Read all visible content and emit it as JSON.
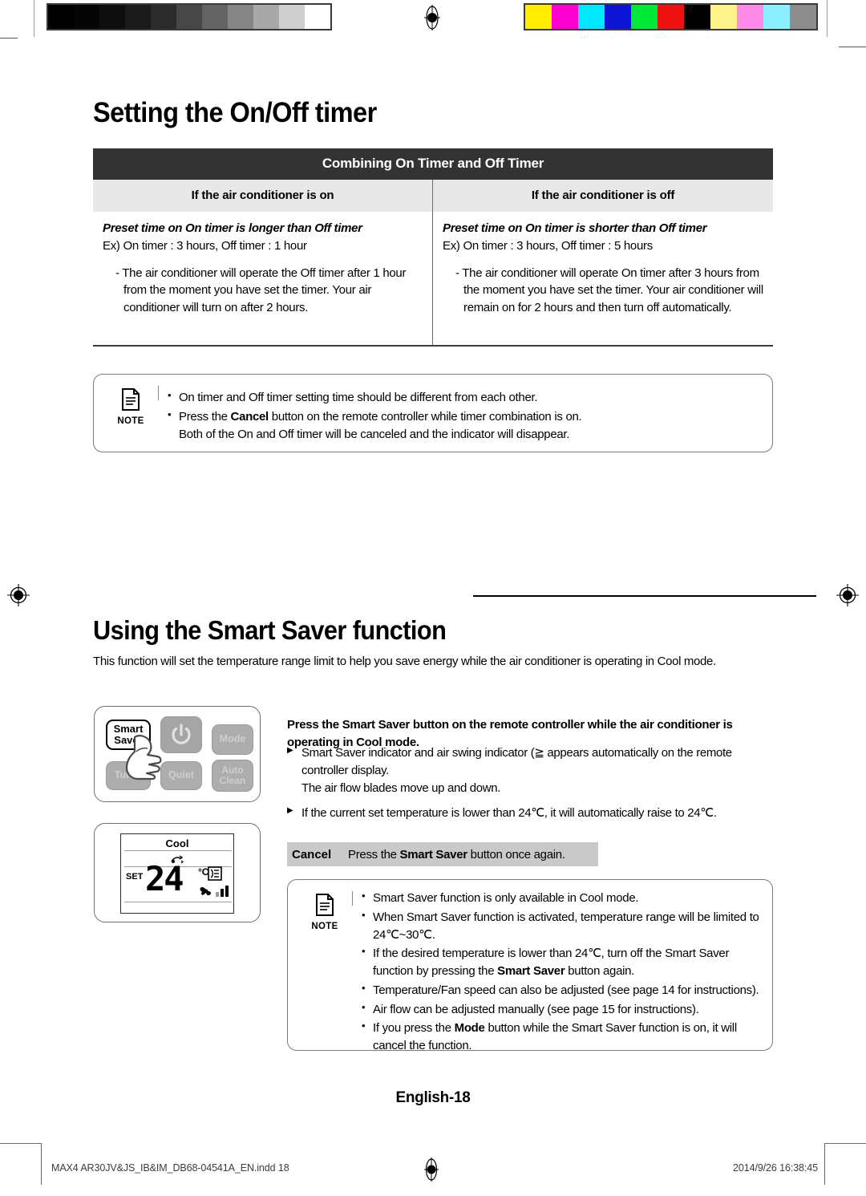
{
  "calibration": {
    "gray_ramp": [
      "#000000",
      "#050505",
      "#0d0d0d",
      "#1a1a1a",
      "#2b2b2b",
      "#474747",
      "#636363",
      "#858585",
      "#a8a8a8",
      "#cfcfcf",
      "#ffffff"
    ],
    "color_ramp": [
      "#ffee00",
      "#ff00d0",
      "#00e8ff",
      "#0e14d6",
      "#00e838",
      "#ee1111",
      "#000000",
      "#fdf38a",
      "#ff8ae8",
      "#8af0ff",
      "#8d8d8d"
    ],
    "reg_mark_icon": "registration-target-icon"
  },
  "section1": {
    "heading": "Setting the On/Off timer",
    "table": {
      "title": "Combining On Timer and Off Timer",
      "columns": [
        "If the air conditioner is on",
        "If the air conditioner is off"
      ],
      "cells": [
        {
          "caption": "Preset time on On timer is longer than Off timer",
          "example": "Ex) On timer : 3 hours, Off timer : 1 hour",
          "detail": "- The air conditioner will operate the Off timer after 1 hour from the moment you have set the timer. Your air conditioner will turn on after 2 hours."
        },
        {
          "caption": "Preset time on On timer is shorter than Off timer",
          "example": "Ex) On timer : 3 hours, Off timer : 5 hours",
          "detail": "- The air conditioner will operate On timer after 3 hours from the moment you have set the timer. Your air conditioner will remain on for 2 hours and then turn off automatically."
        }
      ]
    },
    "note": {
      "label": "NOTE",
      "icon": "note-document-icon",
      "items": [
        {
          "text": "On timer and Off timer setting time should be different from each other."
        },
        {
          "text_pre": "Press the ",
          "bold": "Cancel",
          "text_post": " button on the remote controller while timer combination is on.",
          "sub": "Both of the On and Off timer will be canceled and the indicator will disappear."
        }
      ]
    }
  },
  "section2": {
    "heading": "Using the Smart Saver function",
    "intro": "This function will set the temperature range limit to help you save energy while the air conditioner is operating in Cool mode.",
    "remote": {
      "buttons": [
        {
          "label": "Smart Saver",
          "name": "smart-saver-button"
        },
        {
          "label": "",
          "name": "power-button"
        },
        {
          "label": "Mode",
          "name": "mode-button"
        },
        {
          "label": "Turbo",
          "name": "turbo-button"
        },
        {
          "label": "Quiet",
          "name": "quiet-button"
        },
        {
          "label": "Auto Clean",
          "name": "auto-clean-button"
        }
      ],
      "smart_saver_line1": "Smart",
      "smart_saver_line2": "Saver",
      "mode_label": "Mode",
      "turbo_label": "Turbo",
      "quiet_label": "Quiet",
      "auto_label": "Auto",
      "clean_label": "Clean"
    },
    "lcd": {
      "mode": "Cool",
      "set_label": "SET",
      "temperature": "24",
      "degree": "°C",
      "swing_icon": "air-swing-icon",
      "display_icon": "smart-saver-indicator-icon",
      "fan_icon": "fan-icon",
      "fan_bars": 3
    },
    "instruction": {
      "lead_pre": "Press the ",
      "lead_bold": "Smart Saver",
      "lead_post": " button on the remote controller while the air conditioner is operating in Cool mode.",
      "bullets": [
        {
          "text_pre": "Smart Saver indicator and air swing indicator (",
          "glyph": "≧",
          "text_post": " appears automatically on the remote controller display.",
          "sub": "The air flow blades move up and down."
        },
        {
          "text_pre": "If the current set temperature is lower than 24℃, it will automatically raise to 24℃.",
          "glyph": "",
          "text_post": "",
          "sub": ""
        }
      ]
    },
    "cancel": {
      "title": "Cancel",
      "text_pre": "Press the ",
      "bold": "Smart Saver",
      "text_post": " button once again."
    },
    "note": {
      "label": "NOTE",
      "icon": "note-document-icon",
      "items": [
        {
          "text": "Smart Saver function is only available in Cool mode."
        },
        {
          "text": "When Smart Saver function is activated, temperature range will be limited to 24℃~30℃."
        },
        {
          "text_pre": "If the desired temperature is lower than 24℃, turn off the Smart Saver function by pressing the ",
          "bold": "Smart Saver",
          "text_post": " button again."
        },
        {
          "text": "Temperature/Fan speed can also be adjusted (see page 14 for instructions)."
        },
        {
          "text": "Air flow can be adjusted manually (see page 15 for instructions)."
        },
        {
          "text_pre": "If you press the ",
          "bold": "Mode",
          "text_post": " button while the Smart Saver function is on, it will cancel the function."
        }
      ]
    }
  },
  "footer": {
    "page_label": "English-18",
    "file_name": "MAX4 AR30JV&JS_IB&IM_DB68-04541A_EN.indd   18",
    "timestamp": "2014/9/26   16:38:45"
  }
}
